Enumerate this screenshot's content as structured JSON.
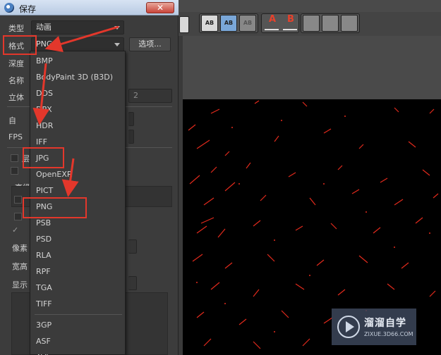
{
  "window": {
    "title": "保存",
    "close_glyph": "✕"
  },
  "form": {
    "type_label": "类型",
    "type_value": "动画",
    "format_label": "格式",
    "format_value": "PNG",
    "options_button": "选项...",
    "depth_label": "深度",
    "name_label": "名称",
    "stereo_label": "立体",
    "stereo_value": "2",
    "auto_label": "自",
    "fps_label": "FPS",
    "layer_label": "层",
    "advanced_label": "高级",
    "pixel_label": "像素",
    "wh_label": "宽高",
    "display_label": "显示",
    "check_glyph": "✓"
  },
  "format_dropdown": {
    "items": [
      "BMP",
      "BodyPaint 3D (B3D)",
      "DDS",
      "DPX",
      "HDR",
      "IFF",
      "JPG",
      "OpenEXR",
      "PICT",
      "PNG",
      "PSB",
      "PSD",
      "RLA",
      "RPF",
      "TGA",
      "TIFF",
      "3GP",
      "ASF",
      "AVI"
    ],
    "selected": "PNG"
  },
  "toolbar": {
    "icons": [
      "text-box-icon",
      "text-outline-icon",
      "text-shadow-icon",
      "move-a-icon",
      "move-b-icon",
      "align-1-icon",
      "align-2-icon",
      "align-3-icon"
    ],
    "a_letter": "A",
    "b_letter": "B",
    "box_text": "AB"
  },
  "watermark": {
    "title": "溜溜自学",
    "subtitle": "ZIXUE.3D66.COM"
  },
  "colors": {
    "highlight": "#e3372b",
    "dialog_bg": "#3c3c3c",
    "viewer_bg": "#000000"
  }
}
